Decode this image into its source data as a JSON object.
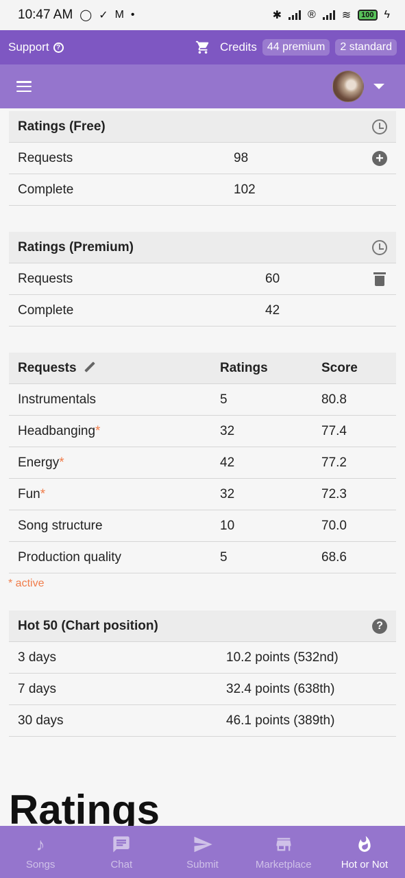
{
  "status_bar": {
    "time": "10:47 AM",
    "battery": "100"
  },
  "topbar": {
    "support_label": "Support",
    "credits_label": "Credits",
    "premium_chip": "44 premium",
    "standard_chip": "2 standard"
  },
  "ratings_free": {
    "title": "Ratings (Free)",
    "rows": [
      {
        "label": "Requests",
        "value": "98"
      },
      {
        "label": "Complete",
        "value": "102"
      }
    ]
  },
  "ratings_premium": {
    "title": "Ratings (Premium)",
    "rows": [
      {
        "label": "Requests",
        "value": "60"
      },
      {
        "label": "Complete",
        "value": "42"
      }
    ]
  },
  "requests_table": {
    "headers": {
      "requests": "Requests",
      "ratings": "Ratings",
      "score": "Score"
    },
    "rows": [
      {
        "name": "Instrumentals",
        "star": "",
        "ratings": "5",
        "score": "80.8"
      },
      {
        "name": "Headbanging",
        "star": "*",
        "ratings": "32",
        "score": "77.4"
      },
      {
        "name": "Energy",
        "star": "*",
        "ratings": "42",
        "score": "77.2"
      },
      {
        "name": "Fun",
        "star": "*",
        "ratings": "32",
        "score": "72.3"
      },
      {
        "name": "Song structure",
        "star": "",
        "ratings": "10",
        "score": "70.0"
      },
      {
        "name": "Production quality",
        "star": "",
        "ratings": "5",
        "score": "68.6"
      }
    ],
    "active_note": "* active"
  },
  "hot50": {
    "title": "Hot 50 (Chart position)",
    "rows": [
      {
        "label": "3 days",
        "value": "10.2 points (532nd)"
      },
      {
        "label": "7 days",
        "value": "32.4 points (638th)"
      },
      {
        "label": "30 days",
        "value": "46.1 points (389th)"
      }
    ]
  },
  "page_heading": "Ratings",
  "bottom_nav": [
    {
      "label": "Songs",
      "icon": "music-note-icon"
    },
    {
      "label": "Chat",
      "icon": "chat-icon"
    },
    {
      "label": "Submit",
      "icon": "send-icon"
    },
    {
      "label": "Marketplace",
      "icon": "store-icon"
    },
    {
      "label": "Hot or Not",
      "icon": "flame-icon"
    }
  ],
  "colors": {
    "topbar": "#7e57c2",
    "appbar": "#9575cd",
    "accent_star": "#f07c4a"
  }
}
